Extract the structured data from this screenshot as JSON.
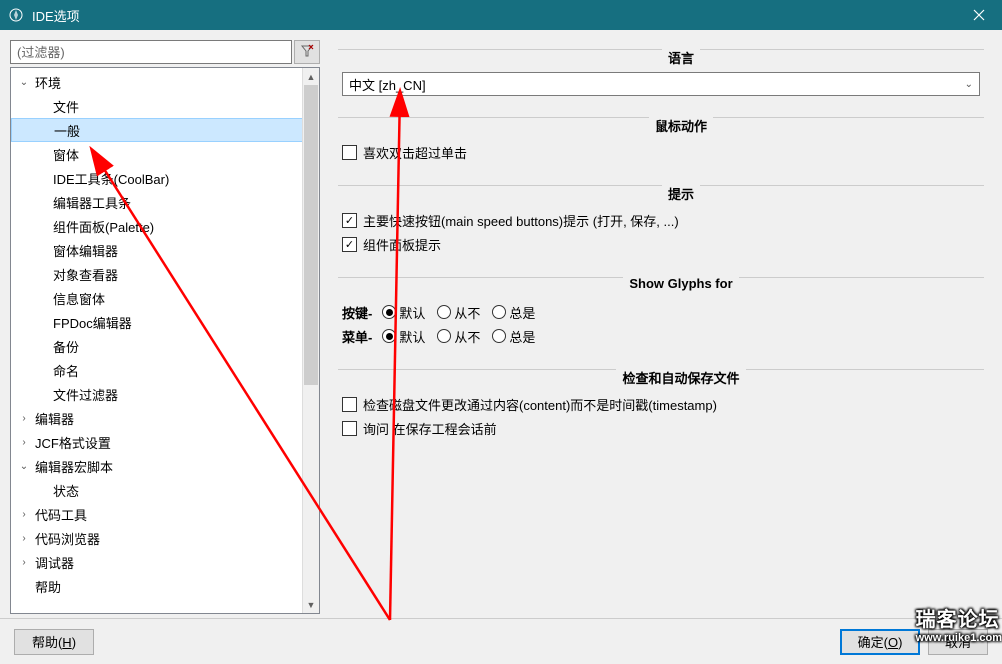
{
  "window": {
    "title": "IDE选项"
  },
  "filter": {
    "placeholder": "(过滤器)"
  },
  "tree": {
    "items": [
      {
        "level": 0,
        "expand": "open",
        "label": "环境"
      },
      {
        "level": 1,
        "expand": "none",
        "label": "文件"
      },
      {
        "level": 1,
        "expand": "none",
        "label": "一般",
        "selected": true
      },
      {
        "level": 1,
        "expand": "none",
        "label": "窗体"
      },
      {
        "level": 1,
        "expand": "none",
        "label": "IDE工具条(CoolBar)"
      },
      {
        "level": 1,
        "expand": "none",
        "label": "编辑器工具条"
      },
      {
        "level": 1,
        "expand": "none",
        "label": "组件面板(Palette)"
      },
      {
        "level": 1,
        "expand": "none",
        "label": "窗体编辑器"
      },
      {
        "level": 1,
        "expand": "none",
        "label": "对象查看器"
      },
      {
        "level": 1,
        "expand": "none",
        "label": "信息窗体"
      },
      {
        "level": 1,
        "expand": "none",
        "label": "FPDoc编辑器"
      },
      {
        "level": 1,
        "expand": "none",
        "label": "备份"
      },
      {
        "level": 1,
        "expand": "none",
        "label": "命名"
      },
      {
        "level": 1,
        "expand": "none",
        "label": "文件过滤器"
      },
      {
        "level": 0,
        "expand": "closed",
        "label": "编辑器"
      },
      {
        "level": 0,
        "expand": "closed",
        "label": "JCF格式设置"
      },
      {
        "level": 0,
        "expand": "open",
        "label": "编辑器宏脚本"
      },
      {
        "level": 1,
        "expand": "none",
        "label": "状态"
      },
      {
        "level": 0,
        "expand": "closed",
        "label": "代码工具"
      },
      {
        "level": 0,
        "expand": "closed",
        "label": "代码浏览器"
      },
      {
        "level": 0,
        "expand": "closed",
        "label": "调试器"
      },
      {
        "level": 0,
        "expand": "none",
        "label": "帮助"
      }
    ]
  },
  "groups": {
    "language": {
      "title": "语言",
      "select_value": "中文 [zh_CN]"
    },
    "mouse": {
      "title": "鼠标动作",
      "dblclick": "喜欢双击超过单击"
    },
    "hints": {
      "title": "提示",
      "speedbtn": "主要快速按钮(main speed buttons)提示 (打开, 保存, ...)",
      "palette": "组件面板提示"
    },
    "glyphs": {
      "title": "Show Glyphs for",
      "row1_label": "按键-",
      "row2_label": "菜单-",
      "opt_default": "默认",
      "opt_never": "从不",
      "opt_always": "总是"
    },
    "autosave": {
      "title": "检查和自动保存文件",
      "bycontent": "检查磁盘文件更改通过内容(content)而不是时间戳(timestamp)",
      "ask": "询问 在保存工程会话前"
    }
  },
  "buttons": {
    "help": "帮助(H)",
    "ok": "确定(O)",
    "cancel": "取消"
  },
  "watermark": {
    "text": "瑞客论坛",
    "url": "www.ruike1.com"
  }
}
